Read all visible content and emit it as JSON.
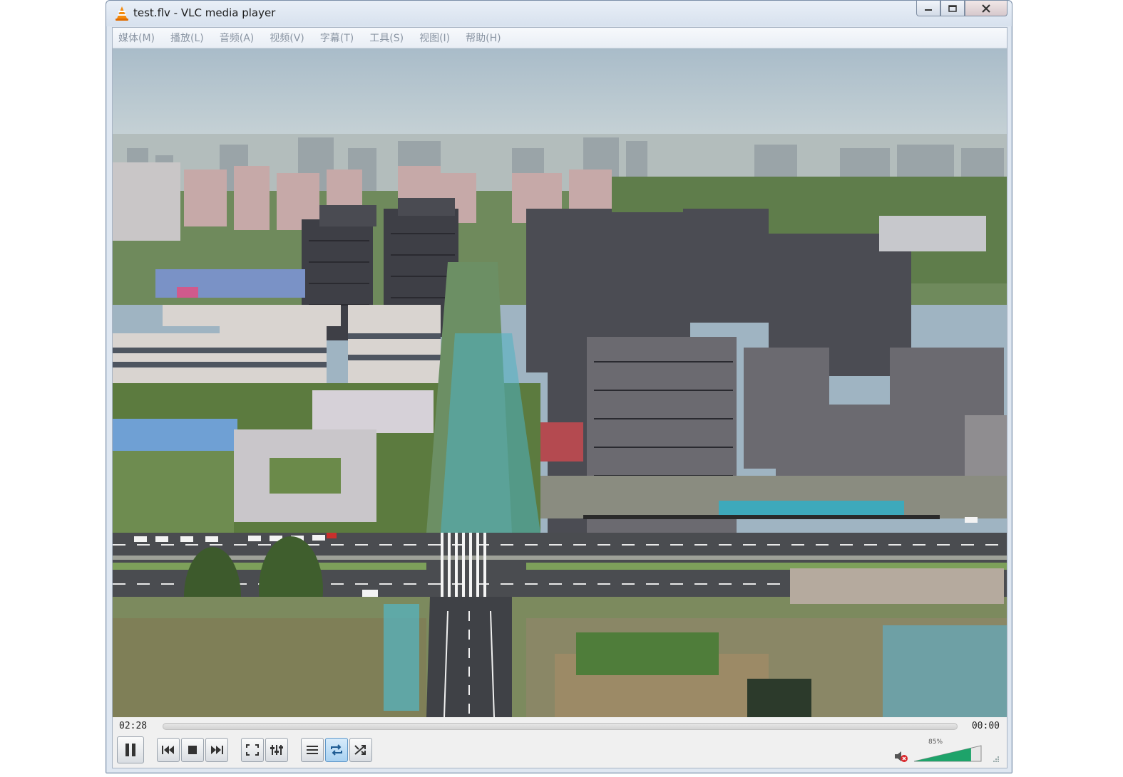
{
  "window": {
    "title": "test.flv - VLC media player"
  },
  "menu": {
    "items": [
      "媒体(M)",
      "播放(L)",
      "音频(A)",
      "视频(V)",
      "字幕(T)",
      "工具(S)",
      "视图(I)",
      "帮助(H)"
    ]
  },
  "playback": {
    "elapsed": "02:28",
    "remaining": "00:00",
    "progress_fraction": 0.0
  },
  "volume": {
    "label": "85%",
    "level_fraction": 0.85,
    "muted": true
  },
  "controls": {
    "icons": [
      "pause-icon",
      "previous-icon",
      "stop-icon",
      "next-icon",
      "fullscreen-icon",
      "extended-settings-icon",
      "playlist-icon",
      "loop-icon",
      "shuffle-icon"
    ]
  },
  "colors": {
    "accent": "#5f97c8",
    "mute_red": "#d9262b",
    "vlc_orange": "#f48a0c"
  }
}
